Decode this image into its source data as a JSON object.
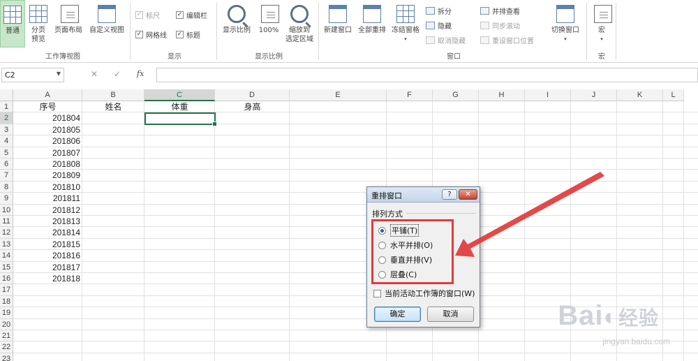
{
  "ribbon": {
    "workbook_views": {
      "group_label": "工作簿视图",
      "normal": "普通",
      "page_break_preview": "分页\n预览",
      "page_layout": "页面布局",
      "custom_views": "自定义视图"
    },
    "show": {
      "group_label": "显示",
      "ruler": "标尺",
      "formula_bar": "编辑栏",
      "gridlines": "网格线",
      "headings": "标题",
      "checkmark": "✓"
    },
    "zoom": {
      "group_label": "显示比例",
      "zoom": "显示比例",
      "zoom_100": "100%",
      "zoom_to_selection": "缩放到\n选定区域"
    },
    "window": {
      "group_label": "窗口",
      "new_window": "新建窗口",
      "arrange_all": "全部重排",
      "freeze_panes": "冻结窗格",
      "split": "拆分",
      "hide": "隐藏",
      "unhide": "取消隐藏",
      "view_side_by_side": "并排查看",
      "sync_scroll": "同步滚动",
      "reset_position": "重设窗口位置",
      "switch_windows": "切换窗口"
    },
    "macros": {
      "group_label": "宏",
      "macros": "宏"
    }
  },
  "formula_bar": {
    "name_box": "C2",
    "cancel_symbol": "✕",
    "enter_symbol": "✓",
    "fx": "fx",
    "content": ""
  },
  "sheet": {
    "columns": [
      "A",
      "B",
      "C",
      "D",
      "E",
      "F",
      "G",
      "H",
      "I",
      "J",
      "K",
      "L"
    ],
    "rows": [
      "1",
      "2",
      "3",
      "4",
      "5",
      "6",
      "7",
      "8",
      "9",
      "10",
      "11",
      "12",
      "13",
      "14",
      "15",
      "16",
      "17",
      "18",
      "19",
      "20",
      "21",
      "22",
      "23"
    ],
    "headers": {
      "A": "序号",
      "B": "姓名",
      "C": "体重",
      "D": "身高"
    },
    "serials": [
      "201804",
      "201805",
      "201806",
      "201807",
      "201808",
      "201809",
      "201810",
      "201811",
      "201812",
      "201813",
      "201814",
      "201815",
      "201816",
      "201817",
      "201818"
    ],
    "active_cell": "C2"
  },
  "dialog": {
    "title": "重排窗口",
    "help": "?",
    "close": "✕",
    "group_label": "排列方式",
    "options": [
      "平铺(T)",
      "水平并排(O)",
      "垂直并排(V)",
      "层叠(C)"
    ],
    "selected_option": "平铺(T)",
    "active_workbook_only": "当前活动工作簿的窗口(W)",
    "ok": "确定",
    "cancel": "取消"
  },
  "annotation": {
    "color": "#e23a3a"
  },
  "watermark": {
    "brand": "Bai",
    "brand_cn": "经验",
    "url": "jingyan.baidu.com"
  }
}
